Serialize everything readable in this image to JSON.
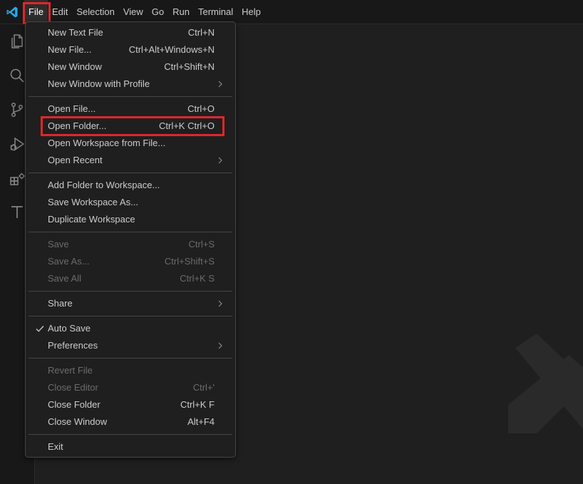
{
  "menubar": [
    "File",
    "Edit",
    "Selection",
    "View",
    "Go",
    "Run",
    "Terminal",
    "Help"
  ],
  "file_menu": {
    "new_text_file": {
      "label": "New Text File",
      "kb": "Ctrl+N"
    },
    "new_file": {
      "label": "New File...",
      "kb": "Ctrl+Alt+Windows+N"
    },
    "new_window": {
      "label": "New Window",
      "kb": "Ctrl+Shift+N"
    },
    "new_window_profile": {
      "label": "New Window with Profile"
    },
    "open_file": {
      "label": "Open File...",
      "kb": "Ctrl+O"
    },
    "open_folder": {
      "label": "Open Folder...",
      "kb": "Ctrl+K Ctrl+O"
    },
    "open_workspace": {
      "label": "Open Workspace from File..."
    },
    "open_recent": {
      "label": "Open Recent"
    },
    "add_folder": {
      "label": "Add Folder to Workspace..."
    },
    "save_workspace_as": {
      "label": "Save Workspace As..."
    },
    "duplicate_workspace": {
      "label": "Duplicate Workspace"
    },
    "save": {
      "label": "Save",
      "kb": "Ctrl+S"
    },
    "save_as": {
      "label": "Save As...",
      "kb": "Ctrl+Shift+S"
    },
    "save_all": {
      "label": "Save All",
      "kb": "Ctrl+K S"
    },
    "share": {
      "label": "Share"
    },
    "auto_save": {
      "label": "Auto Save"
    },
    "preferences": {
      "label": "Preferences"
    },
    "revert_file": {
      "label": "Revert File"
    },
    "close_editor": {
      "label": "Close Editor",
      "kb": "Ctrl+'"
    },
    "close_folder": {
      "label": "Close Folder",
      "kb": "Ctrl+K F"
    },
    "close_window": {
      "label": "Close Window",
      "kb": "Alt+F4"
    },
    "exit": {
      "label": "Exit"
    }
  },
  "colors": {
    "accent_highlight": "#e0262a",
    "logo": "#23a9f2"
  }
}
